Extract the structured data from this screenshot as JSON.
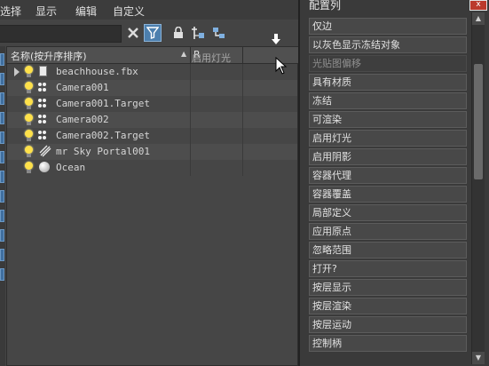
{
  "menu": [
    "选择",
    "显示",
    "编辑",
    "自定义"
  ],
  "table": {
    "name_header": "名称(按升序排序)",
    "r_header": "R",
    "rows": [
      {
        "name": "beachhouse.fbx",
        "type": "file",
        "expandable": true
      },
      {
        "name": "Camera001",
        "type": "camera"
      },
      {
        "name": "Camera001.Target",
        "type": "camera"
      },
      {
        "name": "Camera002",
        "type": "camera"
      },
      {
        "name": "Camera002.Target",
        "type": "camera"
      },
      {
        "name": "mr Sky Portal001",
        "type": "sky-portal"
      },
      {
        "name": "Ocean",
        "type": "sphere"
      }
    ]
  },
  "drag_ghost_label": "启用灯光",
  "config_panel": {
    "title": "配置列",
    "close_label": "x",
    "items": [
      "仅边",
      "以灰色显示冻结对象",
      "光贴图偏移",
      "具有材质",
      "冻结",
      "可渲染",
      "启用灯光",
      "启用阴影",
      "容器代理",
      "容器覆盖",
      "局部定义",
      "应用原点",
      "忽略范围",
      "打开?",
      "按层显示",
      "按层渲染",
      "按层运动",
      "控制柄"
    ],
    "dragging_item": "光贴图偏移"
  },
  "icons": {
    "clear_search": "close-icon",
    "filter": "filter-icon",
    "lock": "lock-icon",
    "select_children": "hierarchy-select-icon",
    "select_dependents": "dependents-select-icon"
  },
  "colors": {
    "accent": "#4c7fae",
    "bulb": "#ffe14a",
    "close": "#bb3a2c"
  }
}
